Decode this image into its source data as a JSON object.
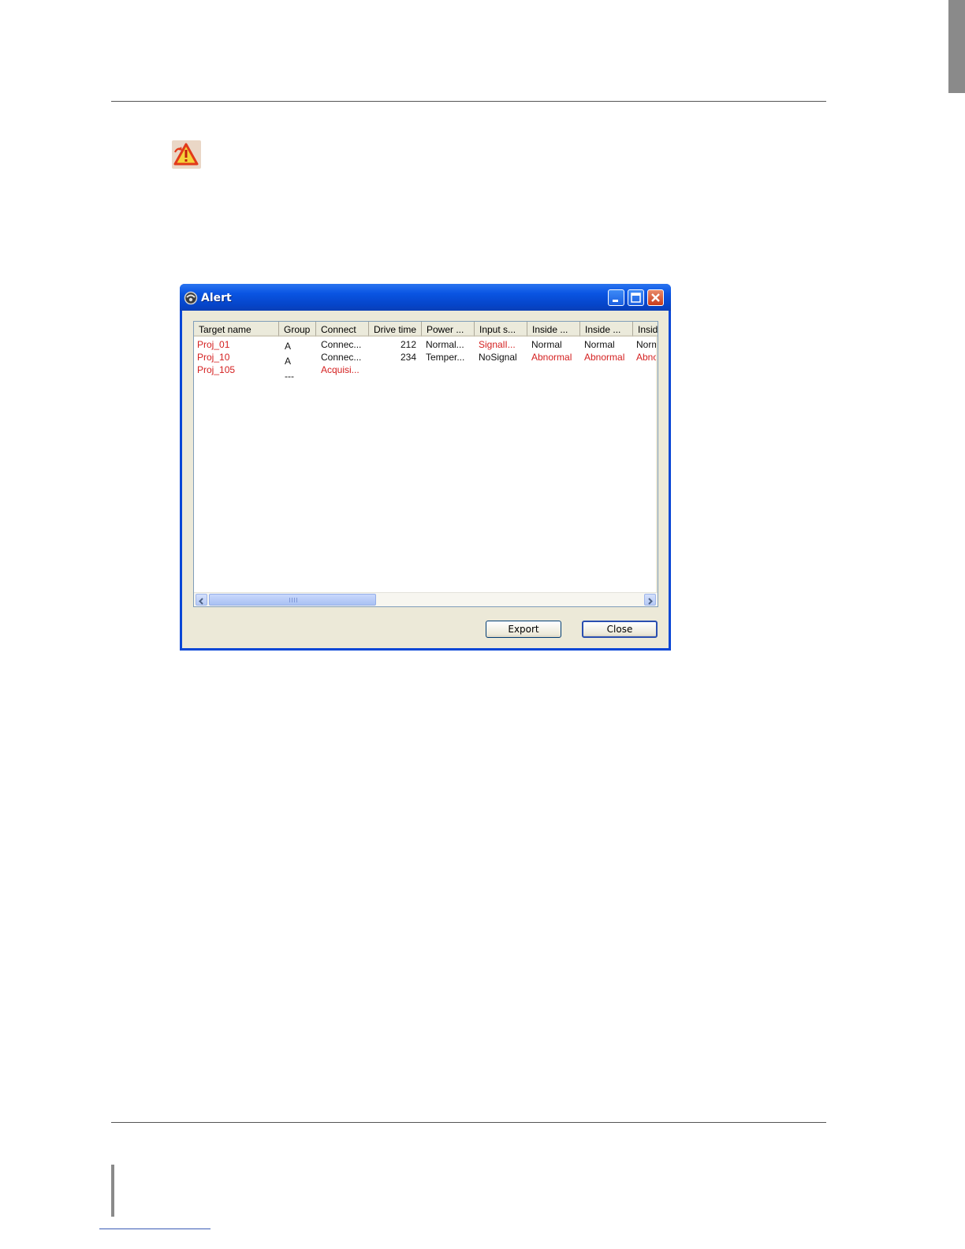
{
  "window": {
    "title": "Alert",
    "min_icon": "minimize-icon",
    "max_icon": "maximize-icon",
    "close_icon": "close-icon",
    "accent": "#0a55e3"
  },
  "columns": [
    "Target name",
    "Group",
    "Connect",
    "Drive time",
    "Power ...",
    "Input s...",
    "Inside ...",
    "Inside ...",
    "Insid"
  ],
  "rows": [
    {
      "target": "Proj_01",
      "group": "A",
      "connect": "Connec...",
      "drive_time": "212",
      "power": "Normal...",
      "input": "SignalI...",
      "inside1": "Normal",
      "inside2": "Normal",
      "inside3": "Norm"
    },
    {
      "target": "Proj_10",
      "group": "A",
      "connect": "Connec...",
      "drive_time": "234",
      "power": "Temper...",
      "input": "NoSignal",
      "inside1": "Abnormal",
      "inside2": "Abnormal",
      "inside3": "Abno"
    },
    {
      "target": "Proj_105",
      "group": "---",
      "connect": "Acquisi..."
    }
  ],
  "buttons": {
    "export": "Export",
    "close": "Close"
  },
  "colors": {
    "alert_text": "#d42020",
    "normal_text": "#111111"
  }
}
